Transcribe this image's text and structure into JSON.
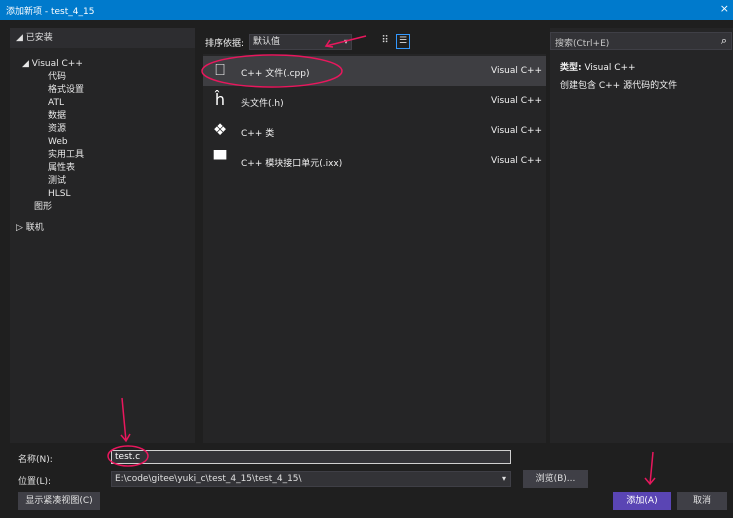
{
  "window": {
    "title": "添加新项 - test_4_15",
    "close_label": "×"
  },
  "left_panel": {
    "header": "◢ 已安装",
    "tree": [
      {
        "label": "◢ Visual C++",
        "indent": 1
      },
      {
        "label": "代码",
        "indent": 2
      },
      {
        "label": "格式设置",
        "indent": 2
      },
      {
        "label": "ATL",
        "indent": 2
      },
      {
        "label": "数据",
        "indent": 2
      },
      {
        "label": "资源",
        "indent": 2
      },
      {
        "label": "Web",
        "indent": 2
      },
      {
        "label": "实用工具",
        "indent": 2
      },
      {
        "label": "属性表",
        "indent": 2
      },
      {
        "label": "测试",
        "indent": 2
      },
      {
        "label": "HLSL",
        "indent": 2
      },
      {
        "label": "图形",
        "indent": 1
      }
    ],
    "online": "▷ 联机"
  },
  "sort": {
    "label": "排序依据:",
    "value": "默认值",
    "dropdown_glyph": "▾",
    "grid_glyph": "⠿",
    "list_glyph": "☰"
  },
  "items": [
    {
      "name": "C++ 文件(.cpp)",
      "lang": "Visual C++",
      "icon": "cpp-file-icon",
      "glyph": "⎕"
    },
    {
      "name": "头文件(.h)",
      "lang": "Visual C++",
      "icon": "header-file-icon",
      "glyph": "ĥ"
    },
    {
      "name": "C++ 类",
      "lang": "Visual C++",
      "icon": "class-icon",
      "glyph": "❖"
    },
    {
      "name": "C++ 模块接口单元(.ixx)",
      "lang": "Visual C++",
      "icon": "module-icon",
      "glyph": "▀"
    }
  ],
  "search": {
    "placeholder": "搜索(Ctrl+E)",
    "icon_glyph": "⌕"
  },
  "details": {
    "type_label": "类型:",
    "type_value": " Visual C++",
    "description": "创建包含 C++ 源代码的文件"
  },
  "form": {
    "name_label": "名称(N):",
    "name_value": "test.c",
    "location_label": "位置(L):",
    "location_value": "E:\\code\\gitee\\yuki_c\\test_4_15\\test_4_15\\",
    "location_dropdown": "▾"
  },
  "buttons": {
    "browse": "浏览(B)...",
    "compact": "显示紧凑视图(C)",
    "add": "添加(A)",
    "cancel": "取消"
  },
  "colors": {
    "accent": "#007acc",
    "annotation": "#e8175d",
    "primary_button": "#5a45b4"
  }
}
